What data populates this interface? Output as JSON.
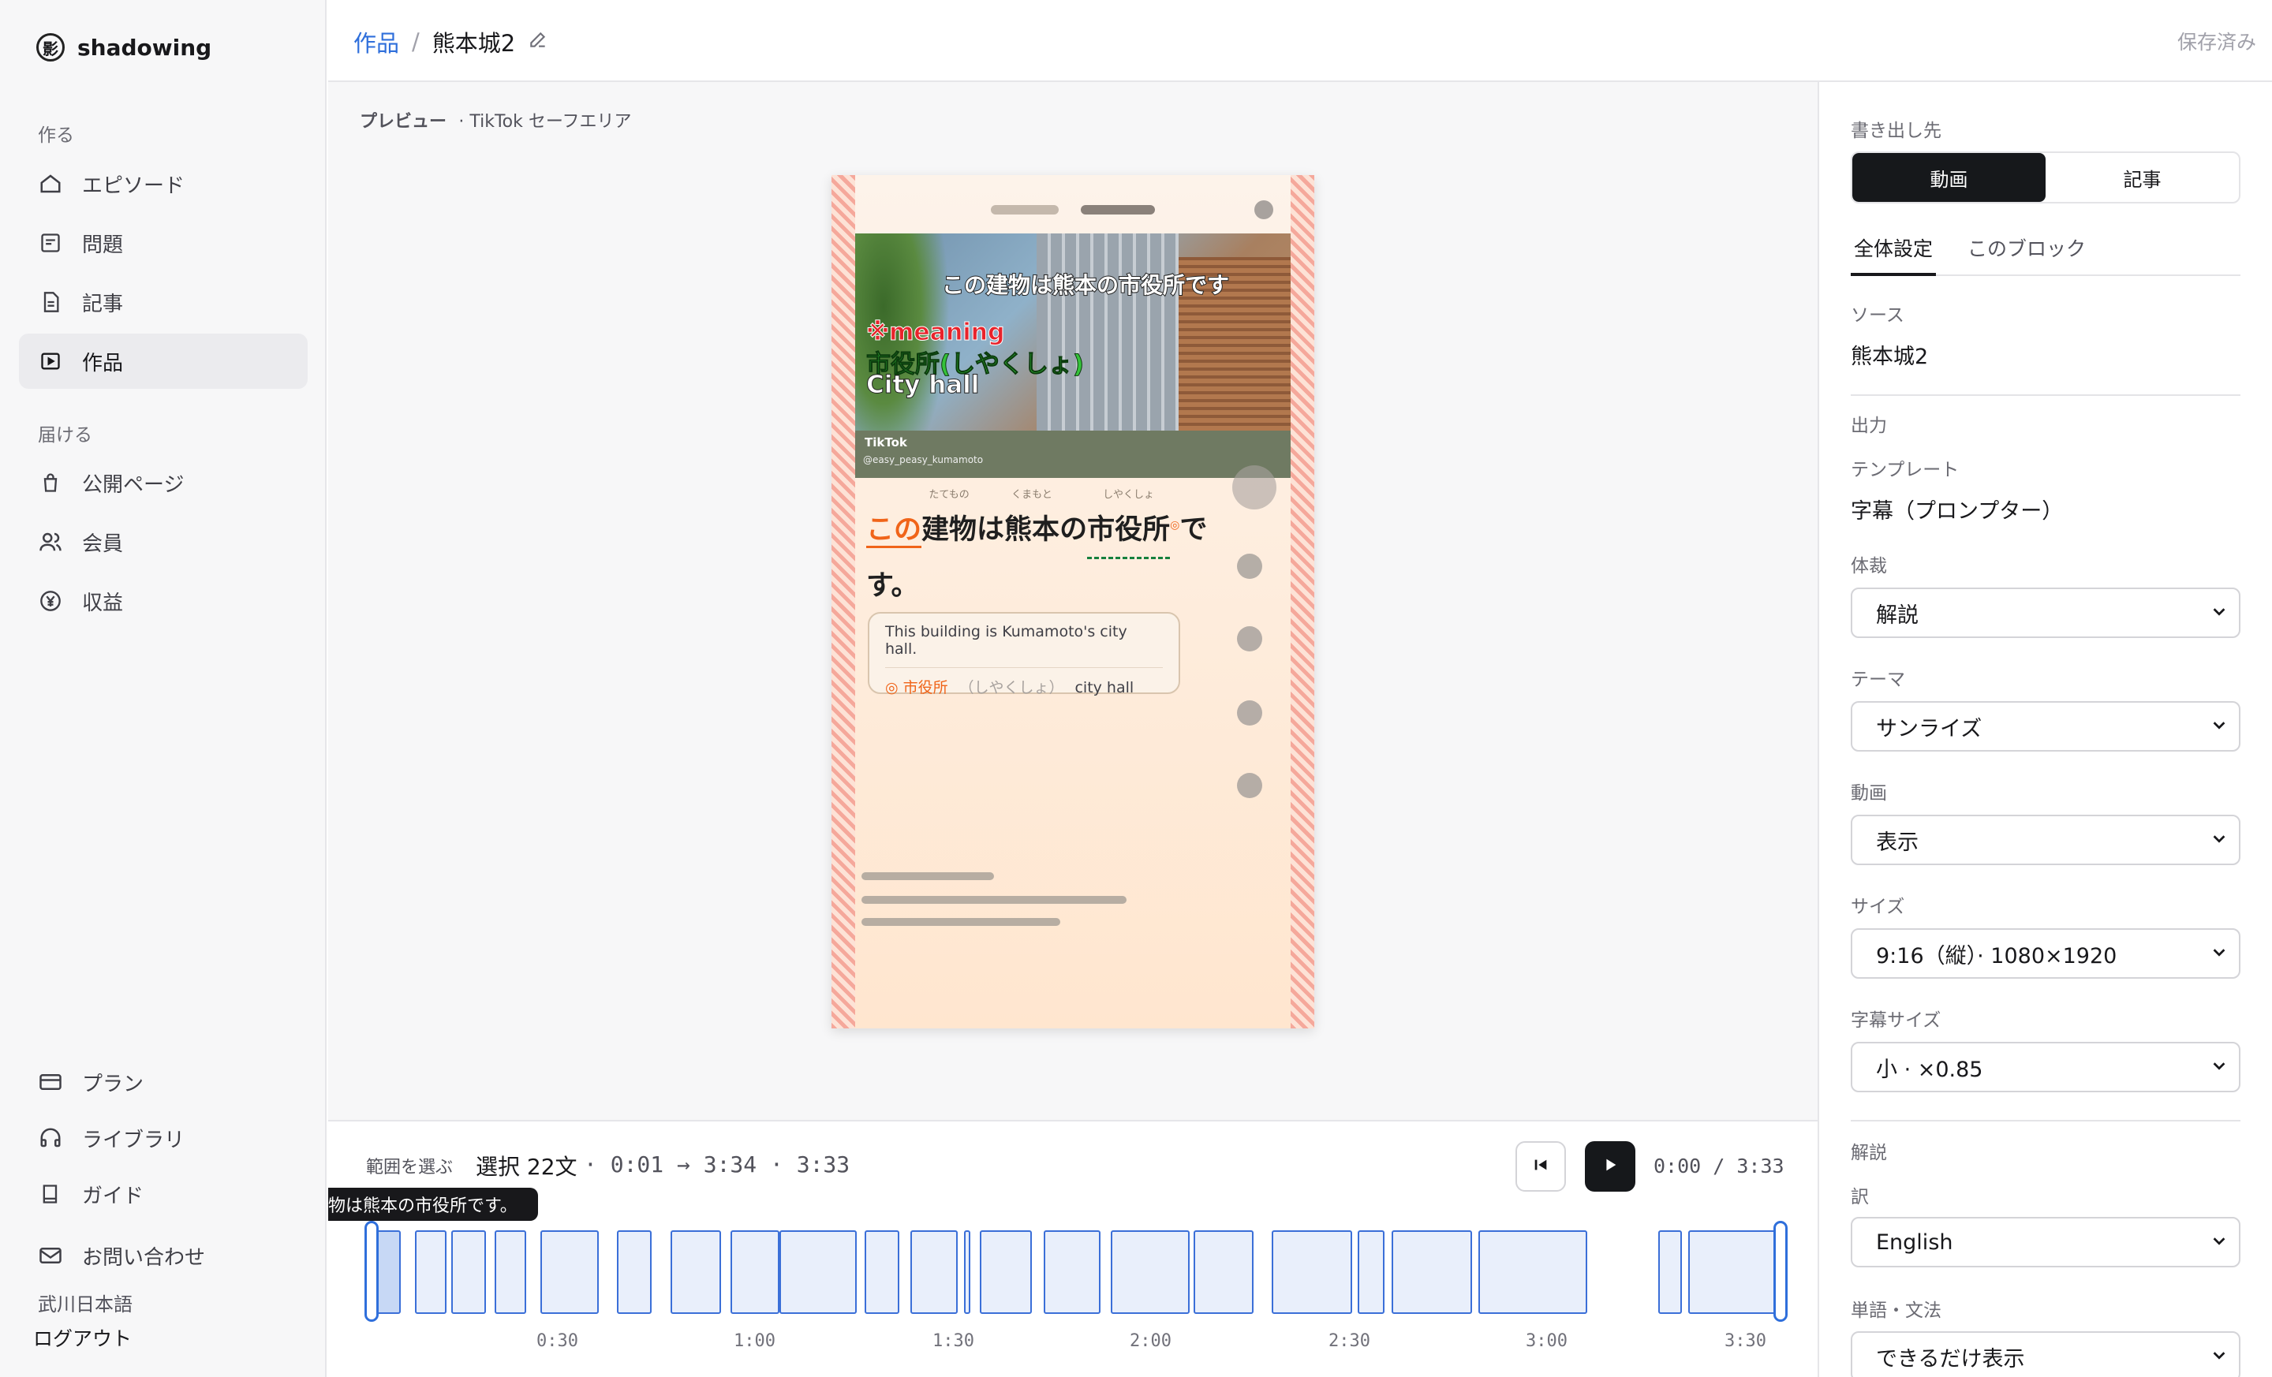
{
  "sidebar": {
    "brand": {
      "mark": "影",
      "name": "shadowing"
    },
    "sections": {
      "create": "作る",
      "deliver": "届ける"
    },
    "items": [
      {
        "label": "エピソード",
        "icon": "home-icon"
      },
      {
        "label": "問題",
        "icon": "note-icon"
      },
      {
        "label": "記事",
        "icon": "document-icon"
      },
      {
        "label": "作品",
        "icon": "video-icon",
        "active": true
      },
      {
        "label": "公開ページ",
        "icon": "bag-icon"
      },
      {
        "label": "会員",
        "icon": "users-icon"
      },
      {
        "label": "収益",
        "icon": "yen-icon"
      }
    ],
    "bottom": [
      {
        "label": "プラン",
        "icon": "card-icon"
      },
      {
        "label": "ライブラリ",
        "icon": "headphones-icon"
      },
      {
        "label": "ガイド",
        "icon": "book-icon"
      },
      {
        "label": "お問い合わせ",
        "icon": "mail-icon"
      }
    ],
    "account": "武川日本語",
    "logout": "ログアウト"
  },
  "header": {
    "breadcrumb_parent": "作品",
    "breadcrumb_sep": "/",
    "title": "熊本城2",
    "status": "保存済み"
  },
  "preview": {
    "label": "プレビュー",
    "safe_area": "· TikTok セーフエリア",
    "video": {
      "caption_top": "この建物は熊本の市役所です",
      "overlay_1": "※meaning",
      "overlay_2": "市役所(しやくしょ)",
      "overlay_3": "City hall",
      "tiktok": "TikTok",
      "handle": "@easy_peasy_kumamoto"
    },
    "sentence": {
      "w1": "この",
      "w2": "建物",
      "w2_ruby": "たてもの",
      "w3": "は",
      "w4": "熊本",
      "w4_ruby": "くまもと",
      "w5": "の",
      "w6": "市役所",
      "w6_ruby": "しやくしょ",
      "mark": "◎",
      "w7": "です。"
    },
    "translation": "This building is Kumamoto's city hall.",
    "glossary": {
      "mark": "◎",
      "word": "市役所",
      "kana": "（しやくしょ）",
      "meaning": "city hall"
    }
  },
  "timeline": {
    "range_label": "範囲を選ぶ",
    "selection": "選択 22文",
    "range": "· 0:01 → 3:34 · 3:33",
    "clock": "0:00 / 3:33",
    "tooltip": "物は熊本の市役所です。",
    "ticks": [
      "0:30",
      "1:00",
      "1:30",
      "2:00",
      "2:30",
      "3:00",
      "3:30"
    ]
  },
  "panel": {
    "export_label": "書き出し先",
    "export_options": [
      "動画",
      "記事"
    ],
    "tabs": [
      "全体設定",
      "このブロック"
    ],
    "source_label": "ソース",
    "source_value": "熊本城2",
    "output_label": "出力",
    "template_label": "テンプレート",
    "template_value": "字幕（プロンプター）",
    "style_label": "体裁",
    "style_value": "解説",
    "theme_label": "テーマ",
    "theme_value": "サンライズ",
    "video_label": "動画",
    "video_value": "表示",
    "size_label": "サイズ",
    "size_value": "9:16（縦）· 1080×1920",
    "subsize_label": "字幕サイズ",
    "subsize_value": "小 · ×0.85",
    "commentary_label": "解説",
    "translation_label": "訳",
    "translation_value": "English",
    "vocab_label": "単語・文法",
    "vocab_value": "できるだけ表示"
  },
  "colors": {
    "accent": "#2f6fdb",
    "highlight": "#f06419",
    "dark": "#16181b"
  }
}
